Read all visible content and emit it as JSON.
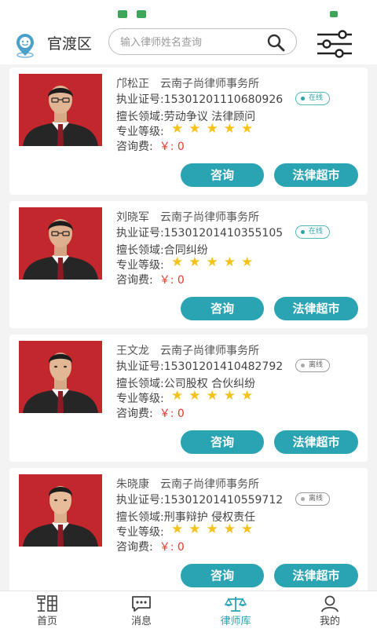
{
  "header": {
    "location": "官渡区",
    "search_placeholder": "输入律师姓名查询"
  },
  "lawyers": [
    {
      "name": "邝松正",
      "firm": "云南子尚律师事务所",
      "license": "执业证号:15301201110680926",
      "status": "在线",
      "status_online": true,
      "specialty": "擅长领域:劳动争议 法律顾问",
      "level_label": "专业等级:",
      "stars": 5,
      "fee_label": "咨询费:",
      "fee_value": "￥: 0",
      "consult_label": "咨询",
      "market_label": "法律超市"
    },
    {
      "name": "刘晓军",
      "firm": "云南子尚律师事务所",
      "license": "执业证号:15301201410355105",
      "status": "在线",
      "status_online": true,
      "specialty": "擅长领域:合同纠纷",
      "level_label": "专业等级:",
      "stars": 5,
      "fee_label": "咨询费:",
      "fee_value": "￥: 0",
      "consult_label": "咨询",
      "market_label": "法律超市"
    },
    {
      "name": "王文龙",
      "firm": "云南子尚律师事务所",
      "license": "执业证号:15301201410482792",
      "status": "离线",
      "status_online": false,
      "specialty": "擅长领域:公司股权 合伙纠纷",
      "level_label": "专业等级:",
      "stars": 5,
      "fee_label": "咨询费:",
      "fee_value": "￥: 0",
      "consult_label": "咨询",
      "market_label": "法律超市"
    },
    {
      "name": "朱晓康",
      "firm": "云南子尚律师事务所",
      "license": "执业证号:15301201410559712",
      "status": "离线",
      "status_online": false,
      "specialty": "擅长领域:刑事辩护 侵权责任",
      "level_label": "专业等级:",
      "stars": 5,
      "fee_label": "咨询费:",
      "fee_value": "￥: 0",
      "consult_label": "咨询",
      "market_label": "法律超市"
    }
  ],
  "tabs": [
    {
      "label": "首页",
      "icon": "home-icon",
      "active": false
    },
    {
      "label": "消息",
      "icon": "message-icon",
      "active": false
    },
    {
      "label": "律师库",
      "icon": "scales-icon",
      "active": true
    },
    {
      "label": "我的",
      "icon": "user-icon",
      "active": false
    }
  ],
  "colors": {
    "accent": "#2aa4b2",
    "star": "#f4c21a",
    "fee": "#e83a2b",
    "photo_bg": "#c1272d"
  }
}
